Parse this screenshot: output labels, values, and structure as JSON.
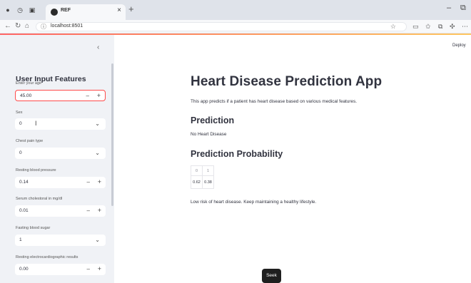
{
  "browser": {
    "tab_title": "REF",
    "tab_close": "×",
    "newtab": "+",
    "url": "localhost:8501",
    "minimize": "–",
    "restore": "⧉"
  },
  "sidebar": {
    "collapse": "‹",
    "header": "User Input Features",
    "fields": [
      {
        "label": "Enter your age",
        "value": "45.00",
        "type": "number"
      },
      {
        "label": "Sex",
        "value": "0",
        "type": "select"
      },
      {
        "label": "Chest pain type",
        "value": "0",
        "type": "select"
      },
      {
        "label": "Resting blood pressure",
        "value": "0.14",
        "type": "number"
      },
      {
        "label": "Serum cholestoral in mg/dl",
        "value": "0.01",
        "type": "number"
      },
      {
        "label": "Fasting blood sugar",
        "value": "1",
        "type": "select"
      },
      {
        "label": "Resting electrocardiographic results",
        "value": "0.00",
        "type": "number"
      }
    ],
    "minus": "–",
    "plus": "+",
    "chevron": "⌄"
  },
  "main": {
    "deploy": "Deploy",
    "title": "Heart Disease Prediction App",
    "intro": "This app predicts if a patient has heart disease based on various medical features.",
    "prediction_heading": "Prediction",
    "prediction_result": "No Heart Disease",
    "probability_heading": "Prediction Probability",
    "probability_table": {
      "headers": [
        "0",
        "1"
      ],
      "values": [
        "0.62",
        "0.38"
      ]
    },
    "advice": "Low risk of heart disease. Keep maintaining a healthy lifestyle.",
    "seek": "Seek"
  },
  "colors": {
    "accent": "#ff4b4b",
    "sidebar_bg": "#f0f2f6",
    "text": "#31333f"
  }
}
